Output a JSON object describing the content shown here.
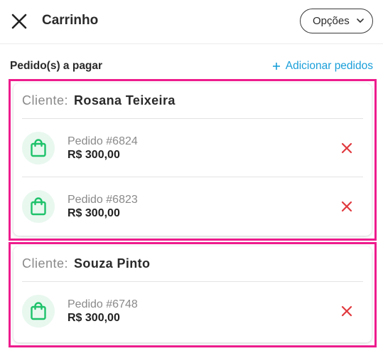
{
  "header": {
    "title": "Carrinho",
    "options_label": "Opções"
  },
  "orders_section": {
    "title": "Pedido(s) a pagar",
    "add_label": "Adicionar pedidos"
  },
  "clients": [
    {
      "label": "Cliente:",
      "name": "Rosana Teixeira",
      "orders": [
        {
          "number": "Pedido #6824",
          "amount": "R$ 300,00"
        },
        {
          "number": "Pedido #6823",
          "amount": "R$ 300,00"
        }
      ]
    },
    {
      "label": "Cliente:",
      "name": "Souza Pinto",
      "orders": [
        {
          "number": "Pedido #6748",
          "amount": "R$ 300,00"
        }
      ]
    }
  ],
  "colors": {
    "accent_link": "#1a9fd9",
    "highlight_border": "#ee1c8d",
    "bag_icon": "#1ec26a",
    "remove_icon": "#e0393e"
  },
  "icons": {
    "close": "close-icon",
    "options_chevron": "chevron-down-icon",
    "add": "plus-icon",
    "order": "shopping-bag-icon",
    "remove": "remove-x-icon"
  }
}
